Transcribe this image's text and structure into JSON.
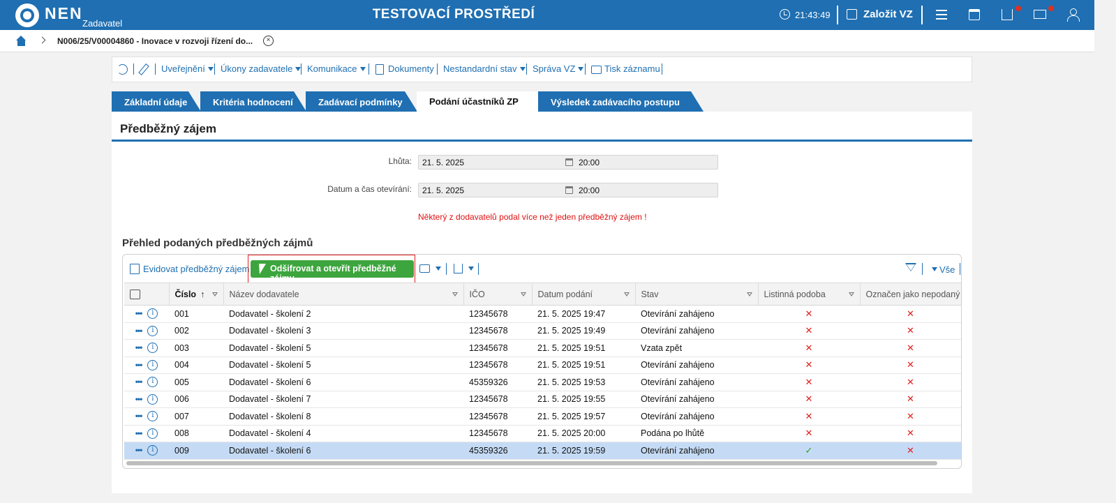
{
  "header": {
    "brand": "NEN",
    "brand_sub": "Zadavatel",
    "env_title": "TESTOVACÍ PROSTŘEDÍ",
    "clock": "21:43:49",
    "create_label": "Založit VZ"
  },
  "breadcrumb": {
    "text": "N006/25/V00004860 - Inovace v rozvoji řízení do...",
    "close": "×"
  },
  "actions": {
    "uverejneni": "Uveřejnění",
    "ukony": "Úkony zadavatele",
    "komunikace": "Komunikace",
    "dokumenty": "Dokumenty",
    "nestandardni": "Nestandardní stav",
    "sprava": "Správa VZ",
    "tisk": "Tisk záznamu"
  },
  "tabs": [
    {
      "label": "Základní údaje"
    },
    {
      "label": "Kritéria hodnocení"
    },
    {
      "label": "Zadávací podmínky"
    },
    {
      "label": "Podání účastníků ZP"
    },
    {
      "label": "Výsledek zadávacího postupu"
    }
  ],
  "section": {
    "title": "Předběžný zájem",
    "deadline_label": "Lhůta:",
    "deadline_date": "21. 5. 2025",
    "deadline_time": "20:00",
    "opening_label": "Datum a čas otevírání:",
    "opening_date": "21. 5. 2025",
    "opening_time": "20:00",
    "warning": "Některý z dodavatelů podal více než jeden předběžný zájem !",
    "overview_title": "Přehled podaných předběžných zájmů"
  },
  "grid_toolbar": {
    "evidovat": "Evidovat předběžný zájem",
    "decrypt": "Odšifrovat a otevřít předběžné zájmy",
    "vse": "Vše"
  },
  "columns": {
    "cislo": "Číslo",
    "nazev": "Název dodavatele",
    "ico": "IČO",
    "datum": "Datum podání",
    "stav": "Stav",
    "listinna": "Listinná podoba",
    "nepodany": "Označen jako nepodaný"
  },
  "rows": [
    {
      "cislo": "001",
      "nazev": "Dodavatel - školení 2",
      "ico": "12345678",
      "datum": "21. 5. 2025 19:47",
      "stav": "Otevírání zahájeno",
      "listinna": "✕",
      "nepodany": "✕"
    },
    {
      "cislo": "002",
      "nazev": "Dodavatel - školení 3",
      "ico": "12345678",
      "datum": "21. 5. 2025 19:49",
      "stav": "Otevírání zahájeno",
      "listinna": "✕",
      "nepodany": "✕"
    },
    {
      "cislo": "003",
      "nazev": "Dodavatel - školení 5",
      "ico": "12345678",
      "datum": "21. 5. 2025 19:51",
      "stav": "Vzata zpět",
      "listinna": "✕",
      "nepodany": "✕"
    },
    {
      "cislo": "004",
      "nazev": "Dodavatel - školení 5",
      "ico": "12345678",
      "datum": "21. 5. 2025 19:51",
      "stav": "Otevírání zahájeno",
      "listinna": "✕",
      "nepodany": "✕"
    },
    {
      "cislo": "005",
      "nazev": "Dodavatel - školení 6",
      "ico": "45359326",
      "datum": "21. 5. 2025 19:53",
      "stav": "Otevírání zahájeno",
      "listinna": "✕",
      "nepodany": "✕"
    },
    {
      "cislo": "006",
      "nazev": "Dodavatel - školení 7",
      "ico": "12345678",
      "datum": "21. 5. 2025 19:55",
      "stav": "Otevírání zahájeno",
      "listinna": "✕",
      "nepodany": "✕"
    },
    {
      "cislo": "007",
      "nazev": "Dodavatel - školení 8",
      "ico": "12345678",
      "datum": "21. 5. 2025 19:57",
      "stav": "Otevírání zahájeno",
      "listinna": "✕",
      "nepodany": "✕"
    },
    {
      "cislo": "008",
      "nazev": "Dodavatel - školení 4",
      "ico": "12345678",
      "datum": "21. 5. 2025 20:00",
      "stav": "Podána po lhůtě",
      "listinna": "✕",
      "nepodany": "✕"
    },
    {
      "cislo": "009",
      "nazev": "Dodavatel - školení 6",
      "ico": "45359326",
      "datum": "21. 5. 2025 19:59",
      "stav": "Otevírání zahájeno",
      "listinna": "✓",
      "nepodany": "✕"
    }
  ],
  "icons": {
    "row_menu": "•••",
    "row_info": "i",
    "sort_asc": "↑"
  },
  "colors": {
    "primary": "#1f6fb2",
    "accent_green": "#3da53d",
    "error_red": "#e01010",
    "selected_row": "#c5dbf5"
  }
}
